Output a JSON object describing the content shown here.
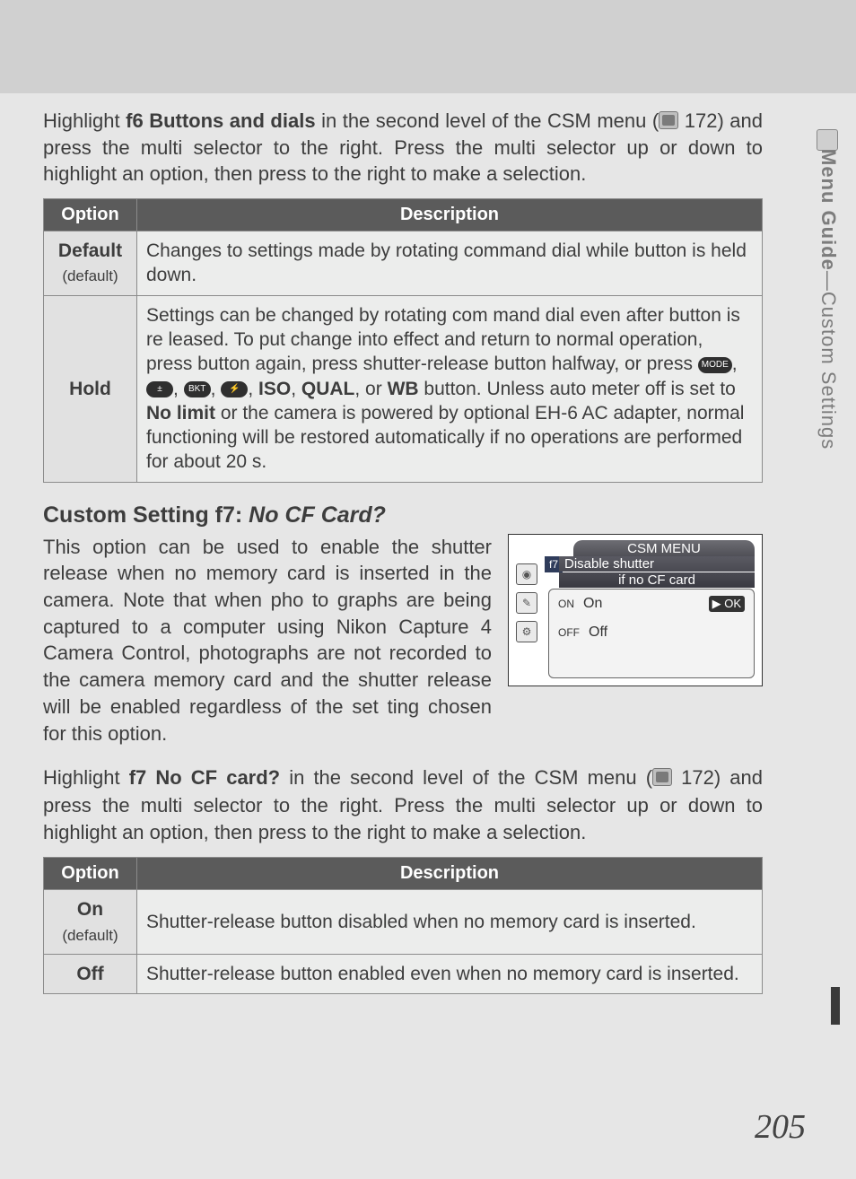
{
  "sidebar_label_a": "Menu Guide",
  "sidebar_label_sep": "—",
  "sidebar_label_b": "Custom Settings",
  "intro": {
    "pre": "Highlight ",
    "bold": "f6 Buttons and dials",
    "mid": " in the second level of the CSM menu (",
    "post": " 172) and press the multi selector to the right.  Press the multi selector up or down to highlight an option, then press to the right to make a selection."
  },
  "table1": {
    "h_option": "Option",
    "h_desc": "Description",
    "rows": [
      {
        "opt_main": "Default",
        "opt_sub": "(default)",
        "desc": "Changes to settings made by rotating command dial while button is held down."
      },
      {
        "opt_main": "Hold",
        "opt_sub": "",
        "desc_pre": "Settings can be changed by rotating com mand dial even after button is re leased.  To put change into effect and return to normal operation, press button again, press shutter-release button halfway, or press ",
        "desc_mid": ", ",
        "desc_bold": "ISO",
        "desc_bold2": "QUAL",
        "desc_bold3": "WB",
        "desc_bold4": "No limit",
        "desc_after_icons": " button.  Unless auto meter off is set to ",
        "desc_tail": " or the camera is powered by optional EH-6 AC adapter, normal functioning will be restored automatically if no operations are performed for about 20 s."
      }
    ]
  },
  "section_title_pre": "Custom Setting f7: ",
  "section_title_it": "No CF Card?",
  "f7_para": "This option can be used to enable the shutter release when no memory card is inserted in the camera.  Note that when pho to graphs are being captured to a computer using Nikon Capture 4 Camera Control, photographs are not recorded to the camera memory card and the shutter release will be enabled regardless of the set ting chosen for this option.",
  "screen": {
    "title": "CSM MENU",
    "f7": "f7",
    "line1": "Disable shutter",
    "line2": "if no CF card",
    "on_badge": "ON",
    "on_label": "On",
    "off_badge": "OFF",
    "off_label": "Off",
    "ok": "OK"
  },
  "intro2": {
    "pre": "Highlight ",
    "bold": "f7 No CF card?",
    "mid": " in the second level of the CSM menu (",
    "post": " 172) and press the multi selector to the right.  Press the multi selector up or down to highlight an option, then press to the right to make a selection."
  },
  "table2": {
    "h_option": "Option",
    "h_desc": "Description",
    "rows": [
      {
        "opt_main": "On",
        "opt_sub": "(default)",
        "desc": "Shutter-release button disabled when no memory card is inserted."
      },
      {
        "opt_main": "Off",
        "opt_sub": "",
        "desc": "Shutter-release button enabled even when no memory card is inserted."
      }
    ]
  },
  "page_number": "205",
  "icons": {
    "mode": "MODE",
    "ev": "±",
    "bkt": "BKT",
    "flash": "⚡"
  }
}
